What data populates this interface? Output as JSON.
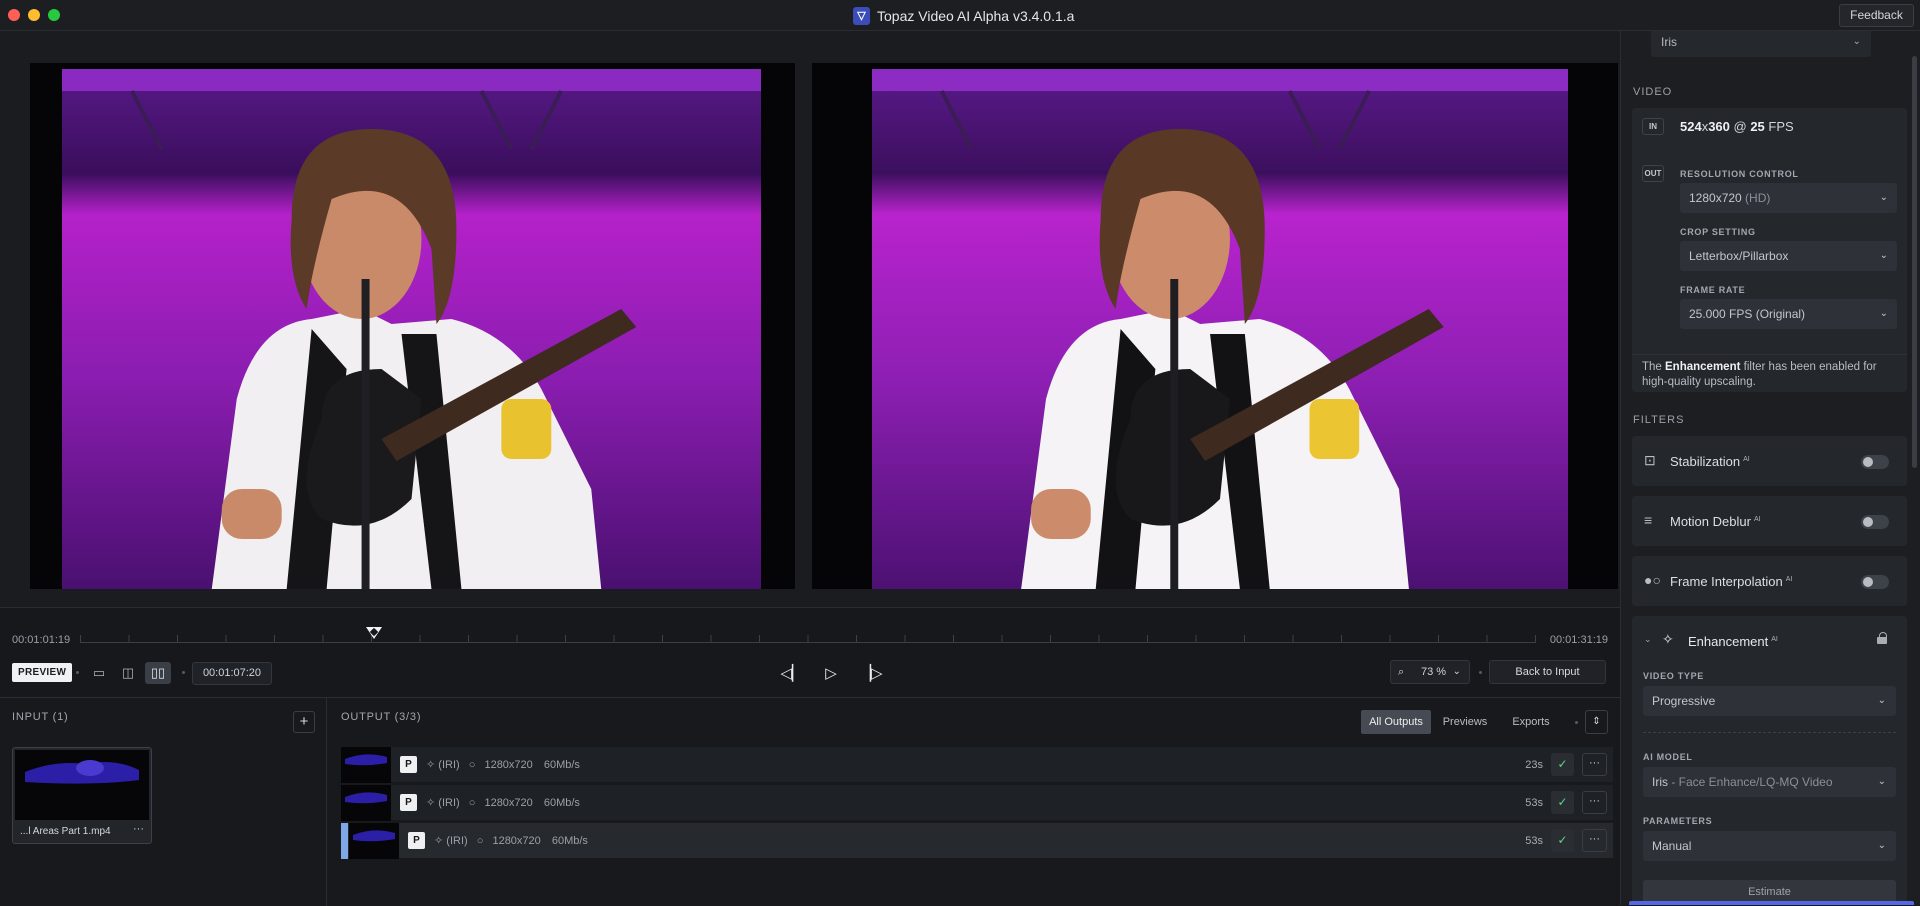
{
  "titlebar": {
    "app_title": "Topaz Video AI Alpha  v3.4.0.1.a",
    "feedback_label": "Feedback"
  },
  "timeline": {
    "start_time": "00:01:01:19",
    "end_time": "00:01:31:19",
    "preview_label": "PREVIEW",
    "current_timecode": "00:01:07:20",
    "zoom_value": "73 %",
    "back_to_input_label": "Back to Input"
  },
  "input": {
    "title": "INPUT (1)",
    "add_label": "+",
    "clip_name": "...l Areas Part 1.mp4",
    "clip_more": "···"
  },
  "output": {
    "title": "OUTPUT (3/3)",
    "tabs": [
      "All Outputs",
      "Previews",
      "Exports"
    ],
    "sort_label": "⇕",
    "rows": [
      {
        "badge": "P",
        "model": "(IRI)",
        "resolution": "1280x720",
        "bitrate": "60Mb/s",
        "time": "23s"
      },
      {
        "badge": "P",
        "model": "(IRI)",
        "resolution": "1280x720",
        "bitrate": "60Mb/s",
        "time": "53s"
      },
      {
        "badge": "P",
        "model": "(IRI)",
        "resolution": "1280x720",
        "bitrate": "60Mb/s",
        "time": "53s"
      }
    ]
  },
  "sidebar": {
    "top_model_value": "Iris",
    "video_section": "VIDEO",
    "in_tag": "IN",
    "input_spec": {
      "width": "524",
      "x": "x",
      "height": "360",
      "at": " @ ",
      "fps": "25",
      "fps_unit": " FPS"
    },
    "out_tag": "OUT",
    "resolution_label": "RESOLUTION CONTROL",
    "resolution_main": "1280x720",
    "resolution_sub": " (HD)",
    "crop_label": "CROP SETTING",
    "crop_value": "Letterbox/Pillarbox",
    "framerate_label": "FRAME RATE",
    "framerate_value": "25.000 FPS (Original)",
    "note_prefix": "The ",
    "note_bold": "Enhancement",
    "note_suffix": " filter has been enabled for high-quality upscaling.",
    "filters_section": "FILTERS",
    "ai_tag": "AI",
    "filters": [
      {
        "label": "Stabilization"
      },
      {
        "label": "Motion Deblur"
      },
      {
        "label": "Frame Interpolation"
      }
    ],
    "enhancement": {
      "label": "Enhancement",
      "video_type_label": "VIDEO TYPE",
      "video_type_value": "Progressive",
      "ai_model_label": "AI MODEL",
      "ai_model_main": "Iris",
      "ai_model_sub": " - Face Enhance/LQ-MQ Video",
      "parameters_label": "PARAMETERS",
      "parameters_value": "Manual",
      "estimate_label": "Estimate"
    }
  },
  "colors": {
    "accent_blue": "#5468e3",
    "check_green": "#5fd38a",
    "stage_purple": "#8d1fb0"
  }
}
